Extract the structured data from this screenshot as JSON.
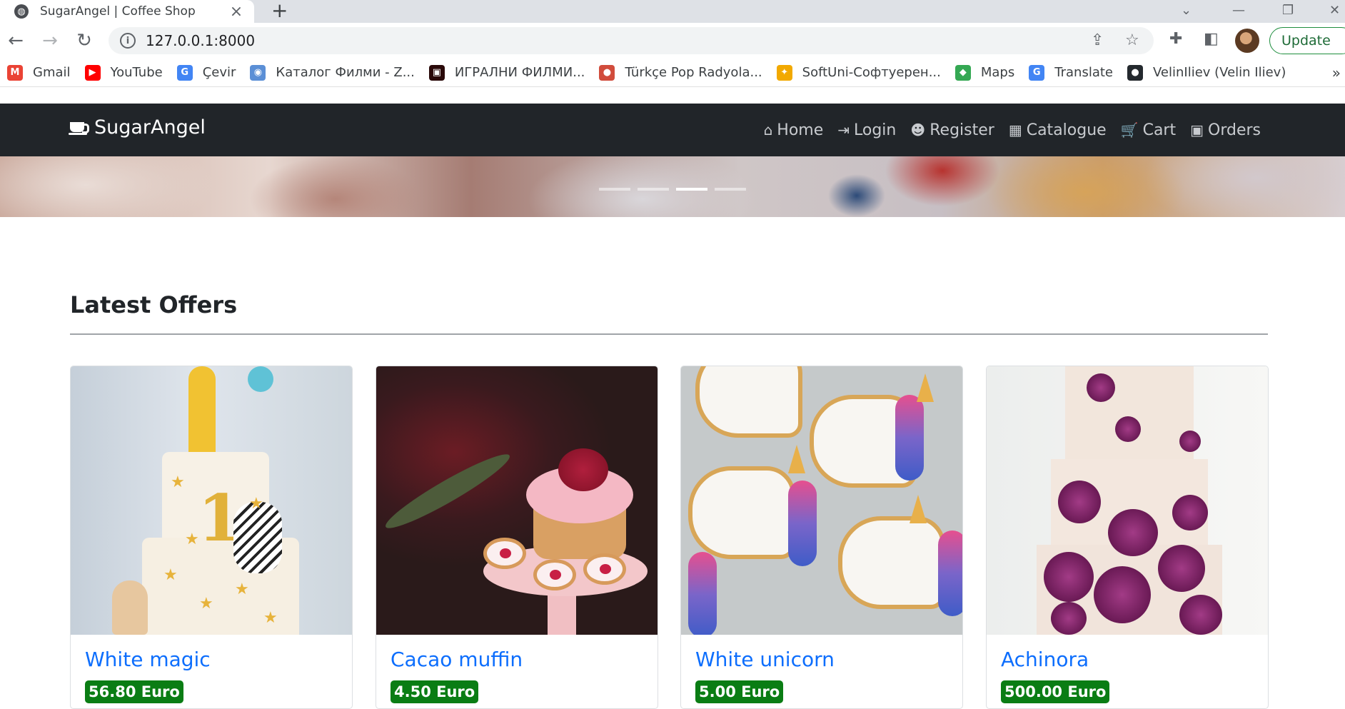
{
  "browser": {
    "tab_title": "SugarAngel | Coffee Shop",
    "url": "127.0.0.1:8000",
    "update_label": "Update",
    "bookmarks": [
      {
        "label": "Gmail",
        "icon": "gmail-icon",
        "color": "#ea4335",
        "glyph": "M"
      },
      {
        "label": "YouTube",
        "icon": "youtube-icon",
        "color": "#ff0000",
        "glyph": "▶"
      },
      {
        "label": "Çevir",
        "icon": "google-translate-icon",
        "color": "#4285f4",
        "glyph": "G"
      },
      {
        "label": "Каталог Филми - Z...",
        "icon": "globe-icon",
        "color": "#5b8fd6",
        "glyph": "◉"
      },
      {
        "label": "ИГРАЛНИ ФИЛМИ...",
        "icon": "film-icon",
        "color": "#2a0a0a",
        "glyph": "▣"
      },
      {
        "label": "Türkçe Pop Radyola...",
        "icon": "radio-icon",
        "color": "#d14c3c",
        "glyph": "●"
      },
      {
        "label": "SoftUni-Софтуерен...",
        "icon": "softuni-icon",
        "color": "#f2a900",
        "glyph": "✦"
      },
      {
        "label": "Maps",
        "icon": "maps-icon",
        "color": "#34a853",
        "glyph": "◆"
      },
      {
        "label": "Translate",
        "icon": "translate-icon",
        "color": "#4285f4",
        "glyph": "G"
      },
      {
        "label": "VelinIliev (Velin Iliev)",
        "icon": "github-icon",
        "color": "#24292e",
        "glyph": "●"
      }
    ]
  },
  "site": {
    "brand": "SugarAngel",
    "nav": [
      {
        "label": "Home",
        "icon": "home-icon",
        "glyph": "⌂"
      },
      {
        "label": "Login",
        "icon": "login-icon",
        "glyph": "⇥"
      },
      {
        "label": "Register",
        "icon": "users-icon",
        "glyph": "☻"
      },
      {
        "label": "Catalogue",
        "icon": "cubes-icon",
        "glyph": "▦"
      },
      {
        "label": "Cart",
        "icon": "cart-icon",
        "glyph": "🛒"
      },
      {
        "label": "Orders",
        "icon": "bag-icon",
        "glyph": "▣"
      }
    ],
    "carousel": {
      "slides": 4,
      "active_index": 2
    }
  },
  "main": {
    "section_title": "Latest Offers",
    "offers": [
      {
        "name": "White magic",
        "price": "56.80 Euro"
      },
      {
        "name": "Cacao muffin",
        "price": "4.50 Euro"
      },
      {
        "name": "White unicorn",
        "price": "5.00 Euro"
      },
      {
        "name": "Achinora",
        "price": "500.00 Euro"
      }
    ]
  },
  "colors": {
    "navbar_bg": "#212529",
    "link_blue": "#0d6efd",
    "price_badge": "#0a7d14"
  }
}
